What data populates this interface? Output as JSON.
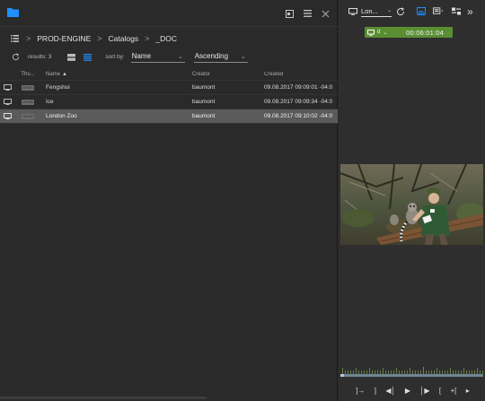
{
  "header": {
    "actions": [
      "panel-toggle-icon",
      "menu-icon",
      "close-icon"
    ]
  },
  "breadcrumb": {
    "root_icon": "list-icon",
    "items": [
      "PROD-ENGINE",
      "Catalogs",
      "_DOC"
    ]
  },
  "toolbar": {
    "results_label": "results: 3",
    "sort_by_label": "sort by:",
    "sort_field": "Name",
    "sort_order": "Ascending"
  },
  "table": {
    "columns": {
      "thumb": "Thu...",
      "name": "Name",
      "creator": "Creator",
      "created": "Created"
    },
    "thumb_chip_label": "AFWB",
    "rows": [
      {
        "name": "Fengshui",
        "creator": "baumont",
        "created": "09.08.2017 09:09:01 -04:0",
        "selected": false
      },
      {
        "name": "Ice",
        "creator": "baumont",
        "created": "09.08.2017 09:09:34 -04:0",
        "selected": false
      },
      {
        "name": "London Zoo",
        "creator": "baumont",
        "created": "09.08.2017 09:10:02 -04:0",
        "selected": true
      }
    ]
  },
  "player": {
    "source_select": "Lon...",
    "timecode_mode": "d",
    "timecode": "00:06:01:04",
    "controls": [
      "mark-in-out-icon",
      "bracket-close-icon",
      "step-back-icon",
      "play-icon",
      "step-forward-icon",
      "bracket-open-icon",
      "add-in-icon",
      "more-icon"
    ]
  },
  "colors": {
    "accent_blue": "#1e90ff",
    "timecode_green": "#5a8e33",
    "selected_row": "#5a5a5a"
  }
}
